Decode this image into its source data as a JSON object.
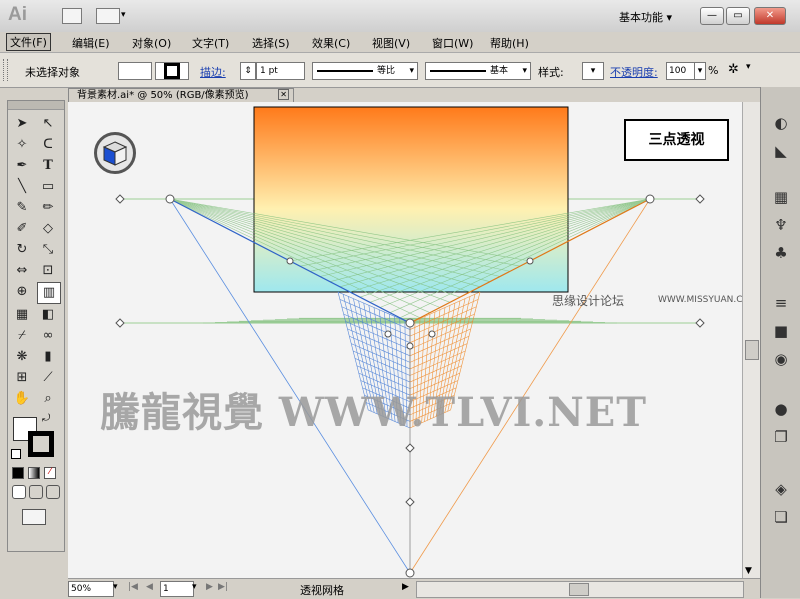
{
  "app": {
    "logo": "Ai",
    "workspace": "基本功能 ▾"
  },
  "window": {
    "minimize": "—",
    "restore": "▭",
    "close": "✕"
  },
  "menu": [
    "文件(F)",
    "编辑(E)",
    "对象(O)",
    "文字(T)",
    "选择(S)",
    "效果(C)",
    "视图(V)",
    "窗口(W)",
    "帮助(H)"
  ],
  "control": {
    "selection": "未选择对象",
    "stroke_label": "描边:",
    "stroke_weight": "1 pt",
    "profile": "等比",
    "brush": "基本",
    "style_label": "样式:",
    "opacity_label": "不透明度:",
    "opacity": "100",
    "percent": "%"
  },
  "document": {
    "tab_title": "背景素材.ai* @ 50% (RGB/像素预览)",
    "tab_close": "✕"
  },
  "canvas": {
    "label": "三点透视",
    "forum": "思缘设计论坛",
    "forum_url": "WWW.MISSYUAN.COM",
    "watermark": "騰龍視覺 WWW.TLVI.NET"
  },
  "status": {
    "zoom": "50%",
    "page": "1",
    "mode": "透视网格"
  },
  "colors": {
    "orange": "#ff7a1a",
    "cyan": "#9fe8ee",
    "grid_blue": "#4a7fd6",
    "grid_orange": "#ef8a2a",
    "grid_green": "#7fbf7a"
  }
}
